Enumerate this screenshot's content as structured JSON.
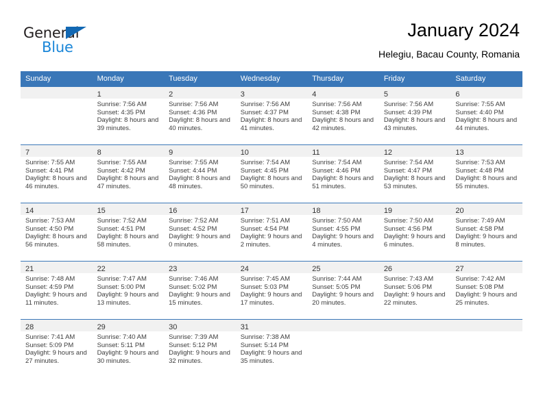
{
  "brand": {
    "name_top": "General",
    "name_bottom": "Blue",
    "accent_color": "#1268b3",
    "secondary_color": "#1a86d8"
  },
  "header": {
    "title": "January 2024",
    "subtitle": "Helegiu, Bacau County, Romania"
  },
  "calendar": {
    "header_color": "#3a77b8",
    "day_band_color": "#f1f1f1",
    "weekday_headers": [
      "Sunday",
      "Monday",
      "Tuesday",
      "Wednesday",
      "Thursday",
      "Friday",
      "Saturday"
    ],
    "weeks": [
      [
        {
          "day": "",
          "sunrise": "",
          "sunset": "",
          "daylight": "",
          "empty": true
        },
        {
          "day": "1",
          "sunrise": "Sunrise: 7:56 AM",
          "sunset": "Sunset: 4:35 PM",
          "daylight": "Daylight: 8 hours and 39 minutes."
        },
        {
          "day": "2",
          "sunrise": "Sunrise: 7:56 AM",
          "sunset": "Sunset: 4:36 PM",
          "daylight": "Daylight: 8 hours and 40 minutes."
        },
        {
          "day": "3",
          "sunrise": "Sunrise: 7:56 AM",
          "sunset": "Sunset: 4:37 PM",
          "daylight": "Daylight: 8 hours and 41 minutes."
        },
        {
          "day": "4",
          "sunrise": "Sunrise: 7:56 AM",
          "sunset": "Sunset: 4:38 PM",
          "daylight": "Daylight: 8 hours and 42 minutes."
        },
        {
          "day": "5",
          "sunrise": "Sunrise: 7:56 AM",
          "sunset": "Sunset: 4:39 PM",
          "daylight": "Daylight: 8 hours and 43 minutes."
        },
        {
          "day": "6",
          "sunrise": "Sunrise: 7:55 AM",
          "sunset": "Sunset: 4:40 PM",
          "daylight": "Daylight: 8 hours and 44 minutes."
        }
      ],
      [
        {
          "day": "7",
          "sunrise": "Sunrise: 7:55 AM",
          "sunset": "Sunset: 4:41 PM",
          "daylight": "Daylight: 8 hours and 46 minutes."
        },
        {
          "day": "8",
          "sunrise": "Sunrise: 7:55 AM",
          "sunset": "Sunset: 4:42 PM",
          "daylight": "Daylight: 8 hours and 47 minutes."
        },
        {
          "day": "9",
          "sunrise": "Sunrise: 7:55 AM",
          "sunset": "Sunset: 4:44 PM",
          "daylight": "Daylight: 8 hours and 48 minutes."
        },
        {
          "day": "10",
          "sunrise": "Sunrise: 7:54 AM",
          "sunset": "Sunset: 4:45 PM",
          "daylight": "Daylight: 8 hours and 50 minutes."
        },
        {
          "day": "11",
          "sunrise": "Sunrise: 7:54 AM",
          "sunset": "Sunset: 4:46 PM",
          "daylight": "Daylight: 8 hours and 51 minutes."
        },
        {
          "day": "12",
          "sunrise": "Sunrise: 7:54 AM",
          "sunset": "Sunset: 4:47 PM",
          "daylight": "Daylight: 8 hours and 53 minutes."
        },
        {
          "day": "13",
          "sunrise": "Sunrise: 7:53 AM",
          "sunset": "Sunset: 4:48 PM",
          "daylight": "Daylight: 8 hours and 55 minutes."
        }
      ],
      [
        {
          "day": "14",
          "sunrise": "Sunrise: 7:53 AM",
          "sunset": "Sunset: 4:50 PM",
          "daylight": "Daylight: 8 hours and 56 minutes."
        },
        {
          "day": "15",
          "sunrise": "Sunrise: 7:52 AM",
          "sunset": "Sunset: 4:51 PM",
          "daylight": "Daylight: 8 hours and 58 minutes."
        },
        {
          "day": "16",
          "sunrise": "Sunrise: 7:52 AM",
          "sunset": "Sunset: 4:52 PM",
          "daylight": "Daylight: 9 hours and 0 minutes."
        },
        {
          "day": "17",
          "sunrise": "Sunrise: 7:51 AM",
          "sunset": "Sunset: 4:54 PM",
          "daylight": "Daylight: 9 hours and 2 minutes."
        },
        {
          "day": "18",
          "sunrise": "Sunrise: 7:50 AM",
          "sunset": "Sunset: 4:55 PM",
          "daylight": "Daylight: 9 hours and 4 minutes."
        },
        {
          "day": "19",
          "sunrise": "Sunrise: 7:50 AM",
          "sunset": "Sunset: 4:56 PM",
          "daylight": "Daylight: 9 hours and 6 minutes."
        },
        {
          "day": "20",
          "sunrise": "Sunrise: 7:49 AM",
          "sunset": "Sunset: 4:58 PM",
          "daylight": "Daylight: 9 hours and 8 minutes."
        }
      ],
      [
        {
          "day": "21",
          "sunrise": "Sunrise: 7:48 AM",
          "sunset": "Sunset: 4:59 PM",
          "daylight": "Daylight: 9 hours and 11 minutes."
        },
        {
          "day": "22",
          "sunrise": "Sunrise: 7:47 AM",
          "sunset": "Sunset: 5:00 PM",
          "daylight": "Daylight: 9 hours and 13 minutes."
        },
        {
          "day": "23",
          "sunrise": "Sunrise: 7:46 AM",
          "sunset": "Sunset: 5:02 PM",
          "daylight": "Daylight: 9 hours and 15 minutes."
        },
        {
          "day": "24",
          "sunrise": "Sunrise: 7:45 AM",
          "sunset": "Sunset: 5:03 PM",
          "daylight": "Daylight: 9 hours and 17 minutes."
        },
        {
          "day": "25",
          "sunrise": "Sunrise: 7:44 AM",
          "sunset": "Sunset: 5:05 PM",
          "daylight": "Daylight: 9 hours and 20 minutes."
        },
        {
          "day": "26",
          "sunrise": "Sunrise: 7:43 AM",
          "sunset": "Sunset: 5:06 PM",
          "daylight": "Daylight: 9 hours and 22 minutes."
        },
        {
          "day": "27",
          "sunrise": "Sunrise: 7:42 AM",
          "sunset": "Sunset: 5:08 PM",
          "daylight": "Daylight: 9 hours and 25 minutes."
        }
      ],
      [
        {
          "day": "28",
          "sunrise": "Sunrise: 7:41 AM",
          "sunset": "Sunset: 5:09 PM",
          "daylight": "Daylight: 9 hours and 27 minutes."
        },
        {
          "day": "29",
          "sunrise": "Sunrise: 7:40 AM",
          "sunset": "Sunset: 5:11 PM",
          "daylight": "Daylight: 9 hours and 30 minutes."
        },
        {
          "day": "30",
          "sunrise": "Sunrise: 7:39 AM",
          "sunset": "Sunset: 5:12 PM",
          "daylight": "Daylight: 9 hours and 32 minutes."
        },
        {
          "day": "31",
          "sunrise": "Sunrise: 7:38 AM",
          "sunset": "Sunset: 5:14 PM",
          "daylight": "Daylight: 9 hours and 35 minutes."
        },
        {
          "day": "",
          "sunrise": "",
          "sunset": "",
          "daylight": "",
          "empty": true
        },
        {
          "day": "",
          "sunrise": "",
          "sunset": "",
          "daylight": "",
          "empty": true
        },
        {
          "day": "",
          "sunrise": "",
          "sunset": "",
          "daylight": "",
          "empty": true
        }
      ]
    ]
  }
}
